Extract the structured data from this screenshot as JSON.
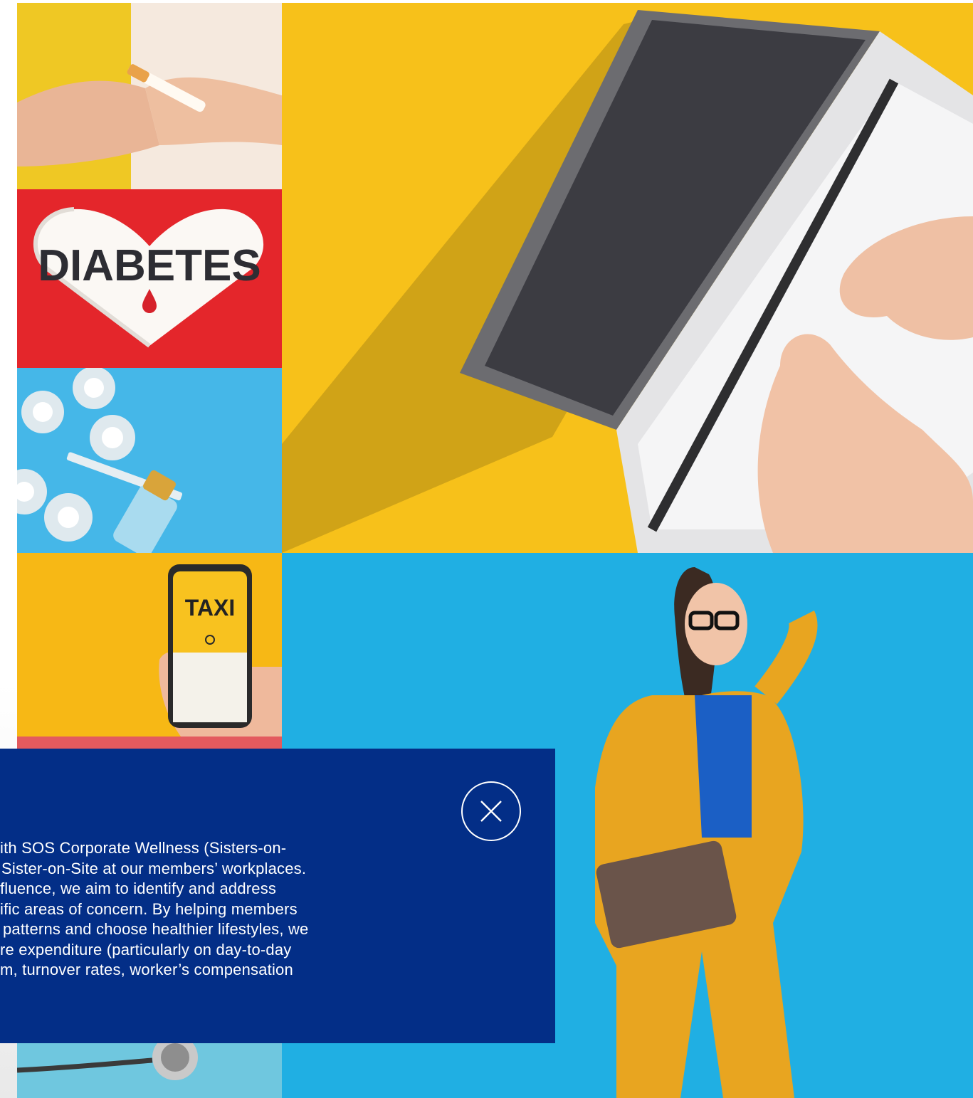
{
  "gallery": {
    "tiles": [
      {
        "name": "quit-smoking-photo",
        "bg": "#f2d23a"
      },
      {
        "name": "diabetes-photo",
        "bg": "#e5282c",
        "photo_text": "DIABETES"
      },
      {
        "name": "medicine-vials-photo",
        "bg": "#43b6e6"
      },
      {
        "name": "taxi-app-photo",
        "bg": "#f7b815",
        "photo_text": "TAXI"
      },
      {
        "name": "stethoscope-photo",
        "bg": "#6fc7df"
      },
      {
        "name": "laptop-typing-photo",
        "bg": "#f7c01a"
      },
      {
        "name": "woman-in-yellow-suit-photo",
        "bg": "#22b0e4"
      }
    ]
  },
  "info_panel": {
    "bg": "#032e87",
    "close_icon": "close-icon",
    "lines": [
      "ith SOS Corporate Wellness (Sisters-on-",
      "Sister-on-Site at our members’ workplaces.",
      "fluence, we aim to identify and address",
      "ific areas of concern. By helping members",
      "patterns and choose healthier lifestyles, we",
      "re expenditure (particularly on day-to-day",
      "m, turnover rates, worker’s compensation"
    ]
  }
}
